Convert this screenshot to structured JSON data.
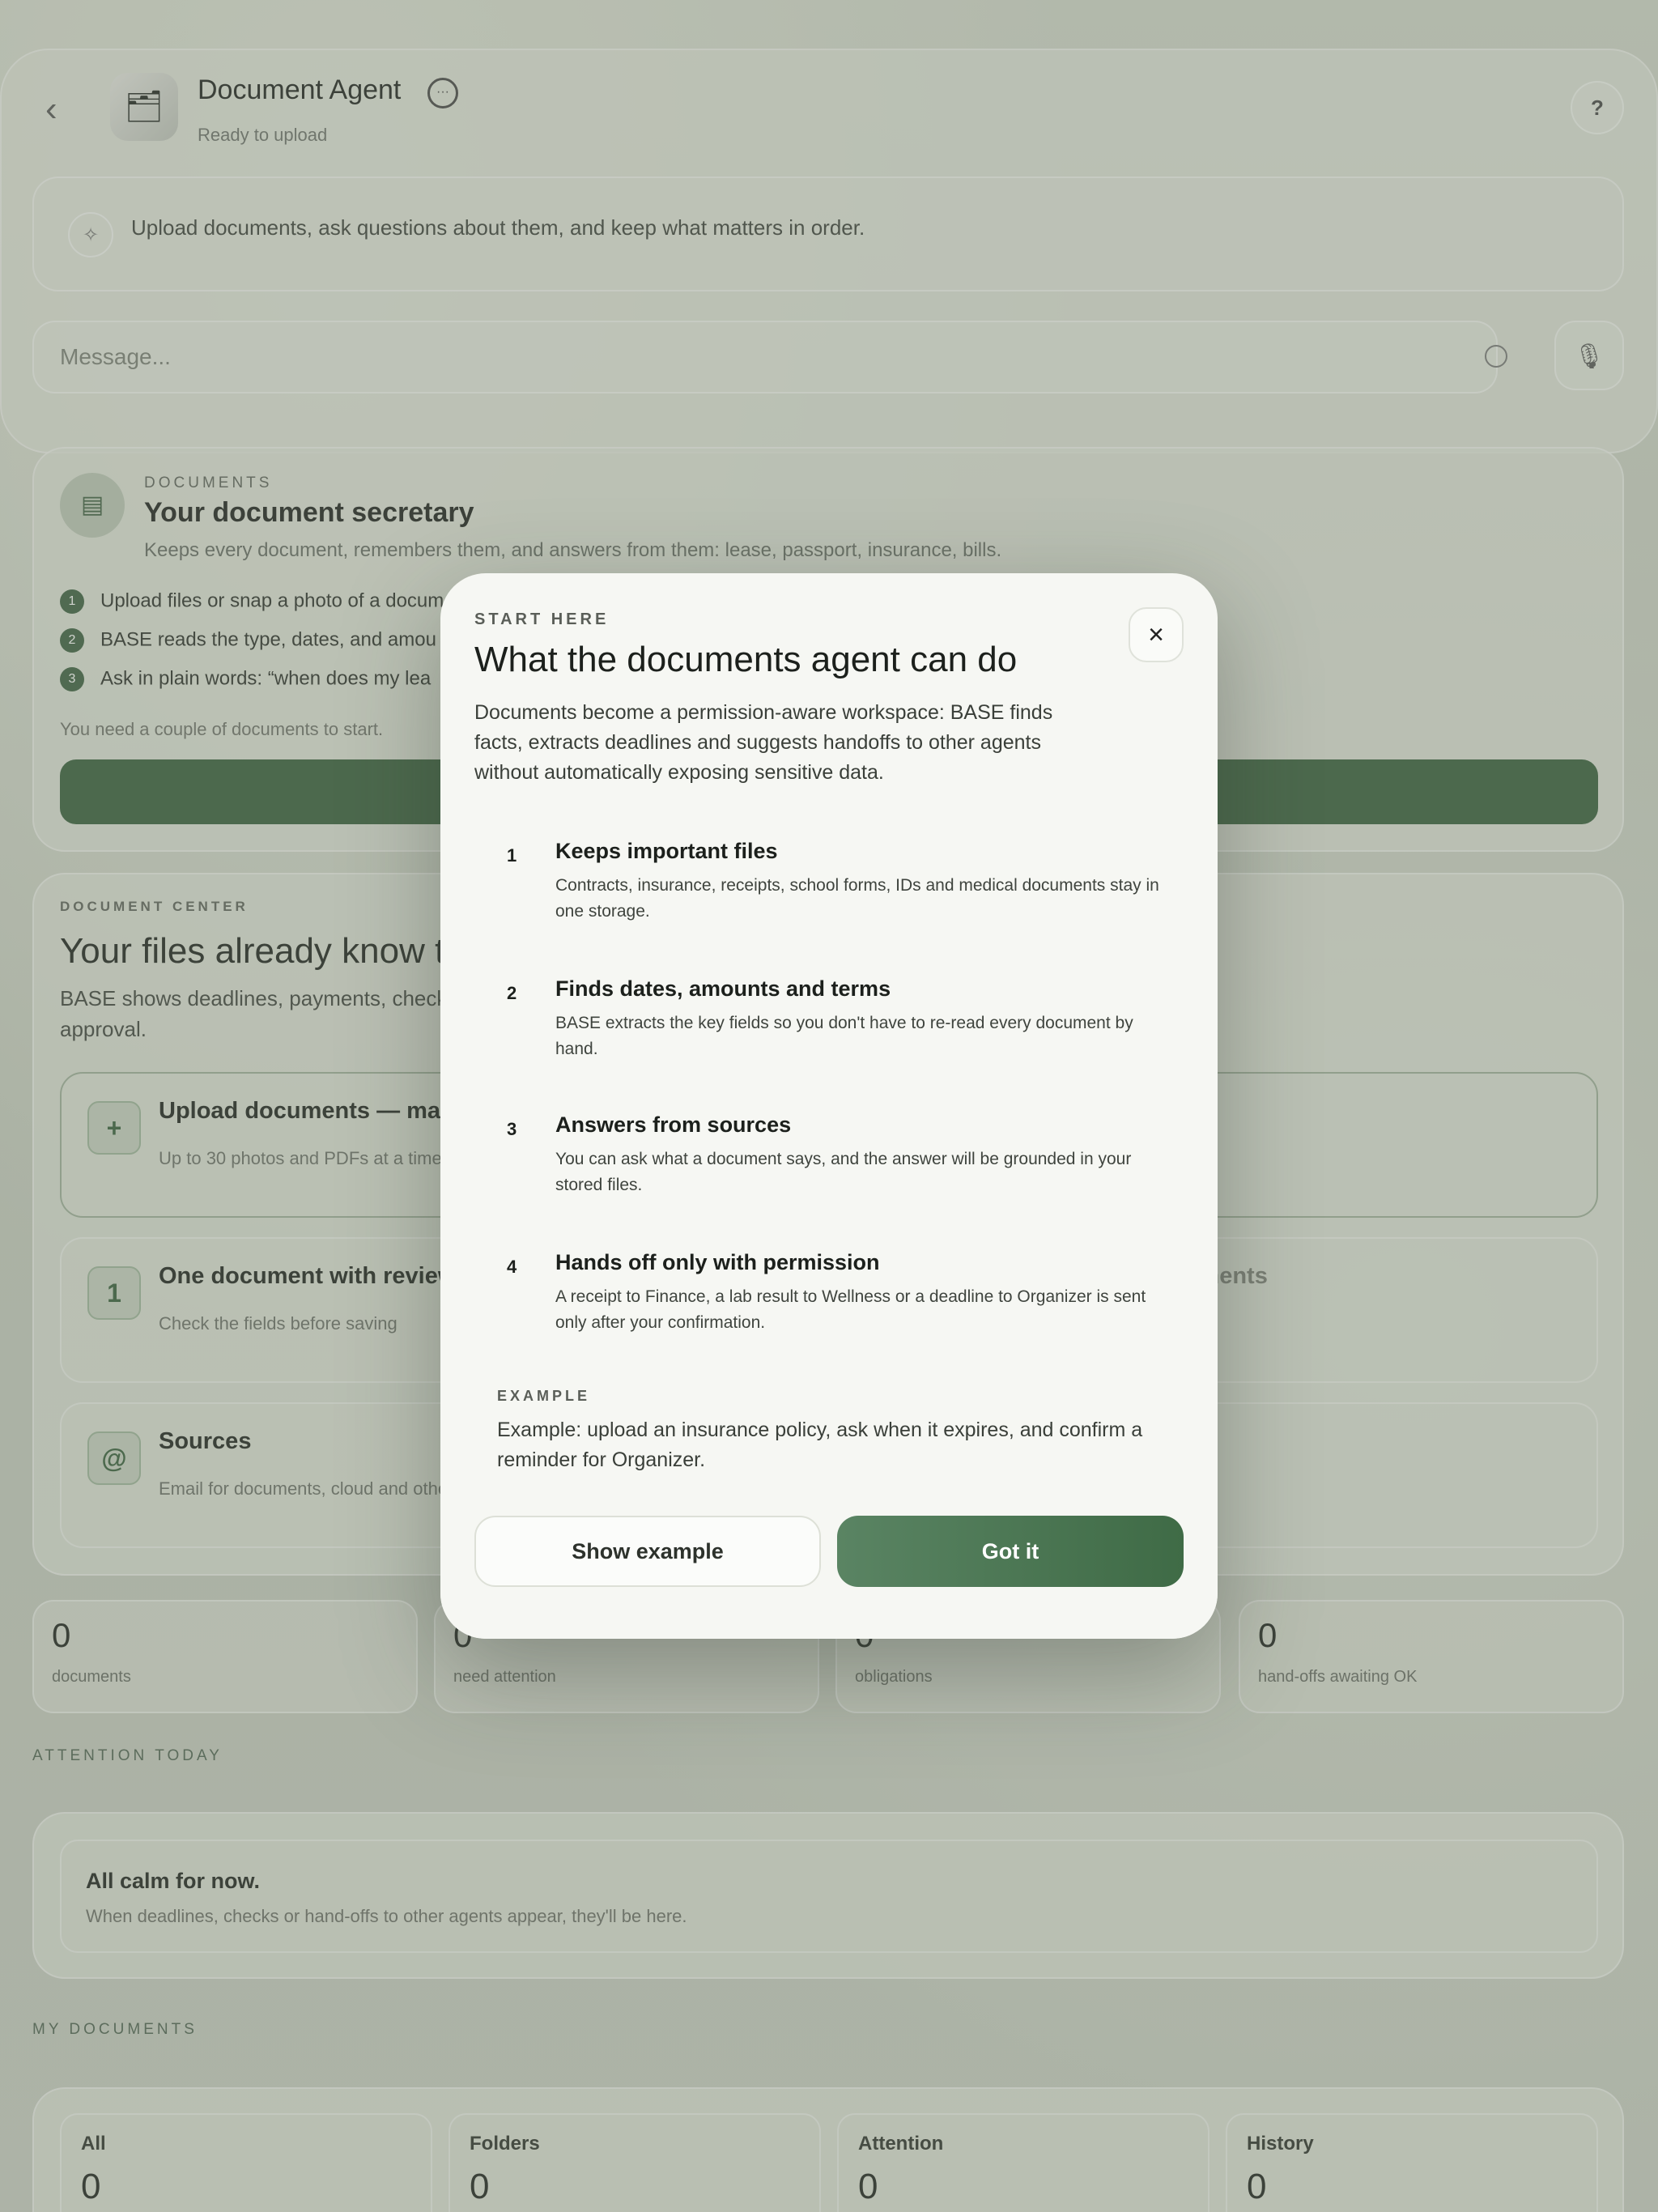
{
  "header": {
    "back_icon": "chevron-left-icon",
    "agent_avatar_icon": "document-stack-icon",
    "title": "Document Agent",
    "status": "Ready to upload",
    "help_label": "?",
    "intro_text": "Upload documents, ask questions about them, and keep what matters in order.",
    "message_placeholder": "Message..."
  },
  "docs_section": {
    "eyebrow": "DOCUMENTS",
    "title": "Your document secretary",
    "subtitle": "Keeps every document, remembers them, and answers from them: lease, passport, insurance, bills.",
    "steps": [
      {
        "num": "1",
        "text": "Upload files or snap a photo of a docum"
      },
      {
        "num": "2",
        "text": "BASE reads the type, dates, and amou"
      },
      {
        "num": "3",
        "text": "Ask in plain words: “when does my lea"
      }
    ],
    "need_text": "You need a couple of documents to start."
  },
  "center": {
    "eyebrow": "DOCUMENT CENTER",
    "title": "Your files already know the next steps.",
    "subtitle": "BASE shows deadlines, payments, checks and hand-offs to other agents before approval.",
    "tiles": [
      {
        "icon": "+",
        "title": "Upload documents — many at once",
        "sub": "Up to 30 photos and PDFs at a time",
        "right": ""
      },
      {
        "icon": "1",
        "title": "One document with review",
        "sub": "Check the fields before saving",
        "right": "Ask about your documents"
      },
      {
        "icon": "@",
        "title": "Sources",
        "sub": "Email for documents, cloud and other sources",
        "right": ""
      }
    ]
  },
  "stats": [
    {
      "value": "0",
      "label": "documents"
    },
    {
      "value": "0",
      "label": "need attention"
    },
    {
      "value": "0",
      "label": "obligations"
    },
    {
      "value": "0",
      "label": "hand-offs awaiting OK"
    }
  ],
  "attention": {
    "label": "ATTENTION TODAY",
    "title": "All calm for now.",
    "subtitle": "When deadlines, checks or hand-offs to other agents appear, they'll be here."
  },
  "my_documents": {
    "label": "MY DOCUMENTS",
    "tabs": [
      {
        "label": "All",
        "value": "0"
      },
      {
        "label": "Folders",
        "value": "0"
      },
      {
        "label": "Attention",
        "value": "0"
      },
      {
        "label": "History",
        "value": "0"
      }
    ]
  },
  "modal": {
    "eyebrow": "START HERE",
    "title": "What the documents agent can do",
    "description": "Documents become a permission-aware workspace: BASE finds facts, extracts deadlines and suggests handoffs to other agents without automatically exposing sensitive data.",
    "close_label": "×",
    "features": [
      {
        "num": "1",
        "title": "Keeps important files",
        "desc": "Contracts, insurance, receipts, school forms, IDs and medical documents stay in one storage."
      },
      {
        "num": "2",
        "title": "Finds dates, amounts and terms",
        "desc": "BASE extracts the key fields so you don't have to re-read every document by hand."
      },
      {
        "num": "3",
        "title": "Answers from sources",
        "desc": "You can ask what a document says, and the answer will be grounded in your stored files."
      },
      {
        "num": "4",
        "title": "Hands off only with permission",
        "desc": "A receipt to Finance, a lab result to Wellness or a deadline to Organizer is sent only after your confirmation."
      }
    ],
    "example_eyebrow": "EXAMPLE",
    "example_text": "Example: upload an insurance policy, ask when it expires, and confirm a reminder for Organizer.",
    "secondary_button": "Show example",
    "primary_button": "Got it"
  },
  "colors": {
    "accent_green": "#3f6b46",
    "modal_bg": "#f6f7f3"
  }
}
